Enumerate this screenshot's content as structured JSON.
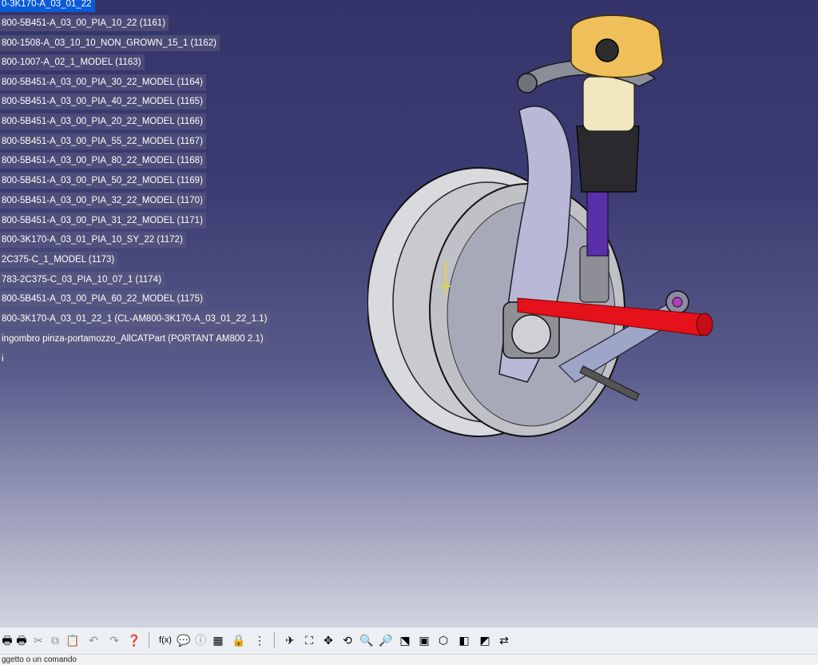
{
  "tree": {
    "items": [
      {
        "label": "0-3K170-A_03_01_22",
        "selected": true
      },
      {
        "label": "800-5B451-A_03_00_PIA_10_22 (1161)"
      },
      {
        "label": "800-1508-A_03_10_10_NON_GROWN_15_1 (1162)"
      },
      {
        "label": "800-1007-A_02_1_MODEL (1163)"
      },
      {
        "label": "800-5B451-A_03_00_PIA_30_22_MODEL (1164)"
      },
      {
        "label": "800-5B451-A_03_00_PIA_40_22_MODEL (1165)"
      },
      {
        "label": "800-5B451-A_03_00_PIA_20_22_MODEL (1166)"
      },
      {
        "label": "800-5B451-A_03_00_PIA_55_22_MODEL (1167)"
      },
      {
        "label": "800-5B451-A_03_00_PIA_80_22_MODEL (1168)"
      },
      {
        "label": "800-5B451-A_03_00_PIA_50_22_MODEL (1169)"
      },
      {
        "label": "800-5B451-A_03_00_PIA_32_22_MODEL (1170)"
      },
      {
        "label": "800-5B451-A_03_00_PIA_31_22_MODEL (1171)"
      },
      {
        "label": "800-3K170-A_03_01_PIA_10_SY_22 (1172)"
      },
      {
        "label": "2C375-C_1_MODEL (1173)"
      },
      {
        "label": "783-2C375-C_03_PIA_10_07_1 (1174)"
      },
      {
        "label": "800-5B451-A_03_00_PIA_60_22_MODEL (1175)"
      },
      {
        "label": "800-3K170-A_03_01_22_1 (CL-AM800-3K170-A_03_01_22_1.1)"
      },
      {
        "label": "ingombro pinza-portamozzo_AllCATPart (PORTANT AM800 2.1)"
      },
      {
        "label": "i"
      }
    ]
  },
  "toolbar": {
    "icons": [
      {
        "name": "print-icon",
        "glyph": "🖶"
      },
      {
        "name": "cut-icon",
        "glyph": "✂"
      },
      {
        "name": "copy-icon",
        "glyph": "⧉"
      },
      {
        "name": "paste-icon",
        "glyph": "📋"
      },
      {
        "name": "undo-icon",
        "glyph": "↶"
      },
      {
        "name": "redo-icon",
        "glyph": "↷"
      },
      {
        "name": "whats-this-icon",
        "glyph": "❓"
      },
      {
        "name": "formula-icon",
        "glyph": "f(x)"
      },
      {
        "name": "knowledge-icon",
        "glyph": "💬"
      },
      {
        "name": "info-icon",
        "glyph": "ⓘ"
      },
      {
        "name": "table-icon",
        "glyph": "▦"
      },
      {
        "name": "lock-icon",
        "glyph": "🔒"
      },
      {
        "name": "tree-expand-icon",
        "glyph": "⋮"
      },
      {
        "name": "fly-mode-icon",
        "glyph": "✈"
      },
      {
        "name": "fit-all-icon",
        "glyph": "⛶"
      },
      {
        "name": "pan-icon",
        "glyph": "✥"
      },
      {
        "name": "rotate-icon",
        "glyph": "⟲"
      },
      {
        "name": "zoom-in-icon",
        "glyph": "🔍"
      },
      {
        "name": "zoom-out-icon",
        "glyph": "🔎"
      },
      {
        "name": "normal-view-icon",
        "glyph": "⬔"
      },
      {
        "name": "multi-view-icon",
        "glyph": "▣"
      },
      {
        "name": "iso-view-icon",
        "glyph": "⬡"
      },
      {
        "name": "shading-icon",
        "glyph": "◧"
      },
      {
        "name": "hide-show-icon",
        "glyph": "◩"
      },
      {
        "name": "swap-space-icon",
        "glyph": "⇄"
      }
    ]
  },
  "status": {
    "prompt": "ggetto o un comando"
  },
  "colors": {
    "selection": "#0a5bd6",
    "viewport_top": "#34346a",
    "viewport_bottom": "#d2d3df"
  }
}
